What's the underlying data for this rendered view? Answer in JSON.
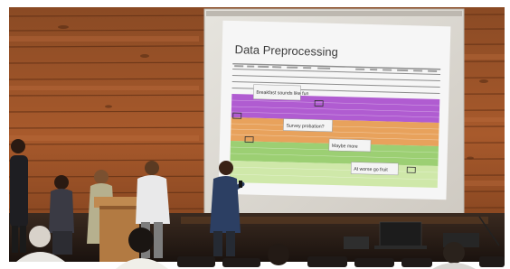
{
  "slide": {
    "title": "Data Preprocessing",
    "annotations": [
      "Breakfast sounds like fun",
      "Survey probation?",
      "Maybe more",
      "At worse go fruit"
    ]
  },
  "colors": {
    "wood_panel": "#a0522d",
    "wall_dark": "#3a2414",
    "screen_frame": "#d9d6cf",
    "slide_bg": "#f6f6f6",
    "band_purple": "#b05cd1",
    "band_orange": "#e8a25c",
    "band_green_dark": "#9ccf73",
    "band_green_light": "#cfe8a9"
  }
}
